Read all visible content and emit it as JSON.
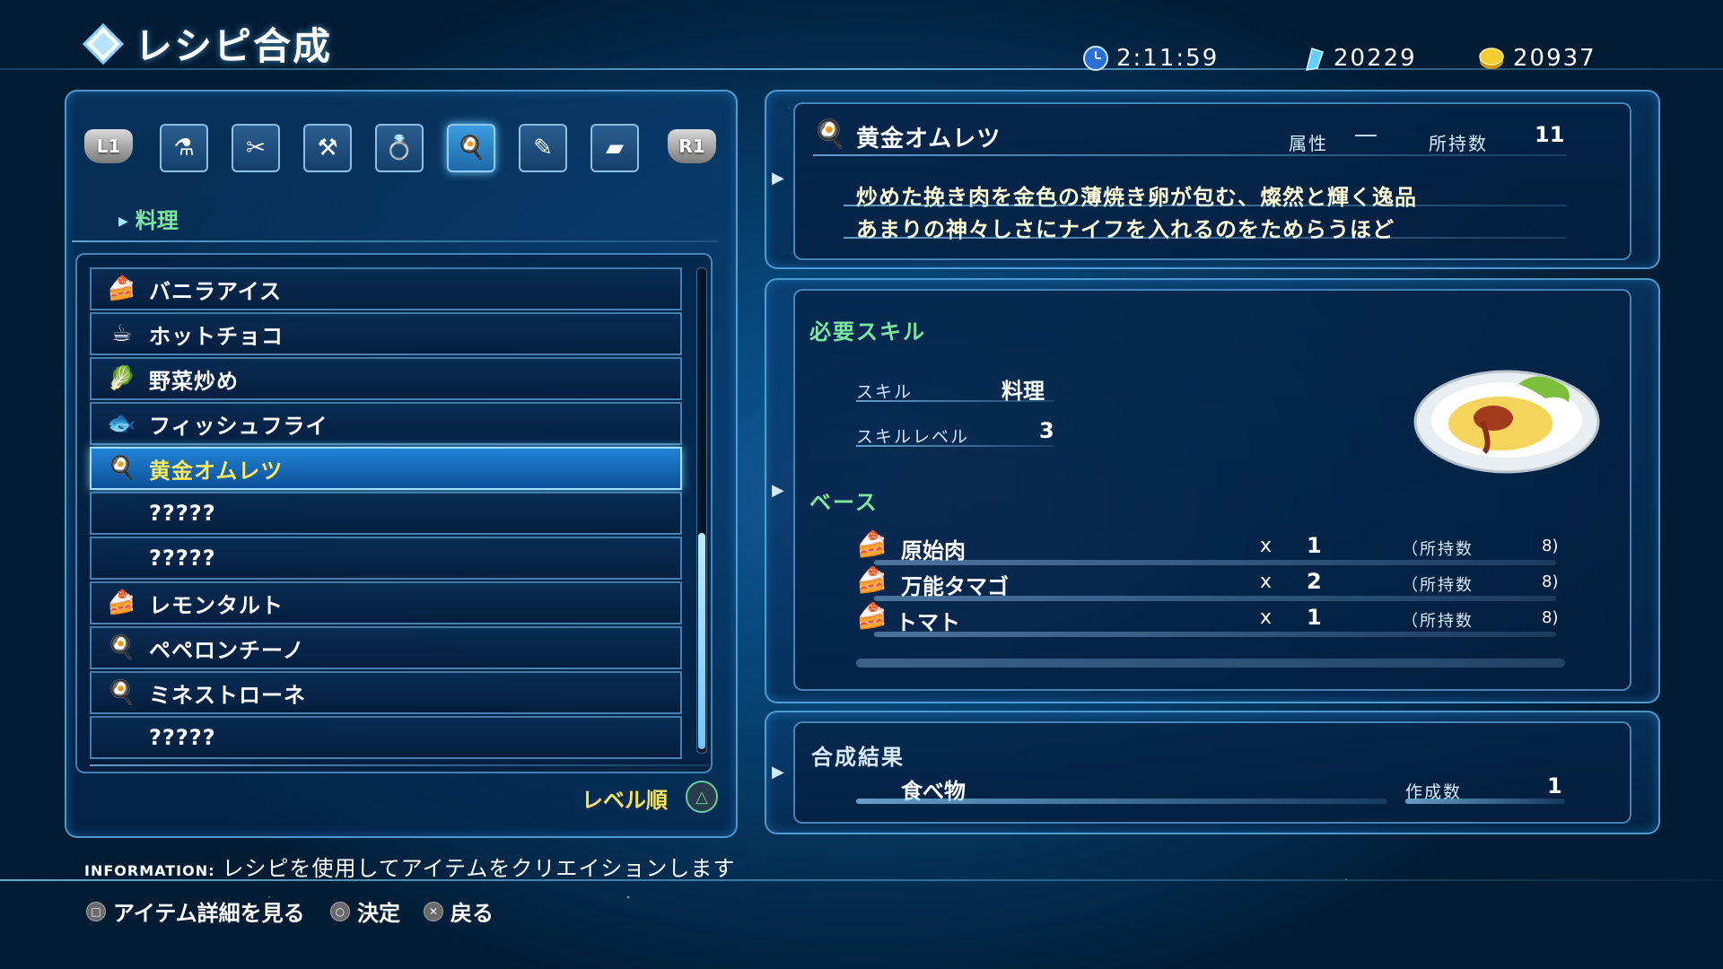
{
  "header": {
    "title": "レシピ合成",
    "time": "2:11:59",
    "crystals": "20229",
    "money": "20937"
  },
  "tabs": {
    "l1": "L1",
    "r1": "R1",
    "items": [
      {
        "icon": "potion-icon",
        "glyph": "⚗"
      },
      {
        "icon": "tools-icon",
        "glyph": "✂"
      },
      {
        "icon": "hammer-icon",
        "glyph": "⚒"
      },
      {
        "icon": "ring-icon",
        "glyph": "💍"
      },
      {
        "icon": "cooking-icon",
        "glyph": "🍳",
        "selected": true
      },
      {
        "icon": "writing-icon",
        "glyph": "✎"
      },
      {
        "icon": "ingot-icon",
        "glyph": "▰"
      }
    ]
  },
  "category": "料理",
  "recipes": [
    {
      "name": "バニラアイス",
      "icon": "cake-icon",
      "glyph": "🍰"
    },
    {
      "name": "ホットチョコ",
      "icon": "cup-icon",
      "glyph": "☕"
    },
    {
      "name": "野菜炒め",
      "icon": "vegetable-icon",
      "glyph": "🥬"
    },
    {
      "name": "フィッシュフライ",
      "icon": "fish-icon",
      "glyph": "🐟"
    },
    {
      "name": "黄金オムレツ",
      "icon": "omelet-icon",
      "glyph": "🍳",
      "selected": true
    },
    {
      "name": "?????",
      "icon": "",
      "glyph": ""
    },
    {
      "name": "?????",
      "icon": "",
      "glyph": ""
    },
    {
      "name": "レモンタルト",
      "icon": "cake-icon",
      "glyph": "🍰"
    },
    {
      "name": "ペペロンチーノ",
      "icon": "omelet-icon",
      "glyph": "🍳"
    },
    {
      "name": "ミネストローネ",
      "icon": "omelet-icon",
      "glyph": "🍳"
    },
    {
      "name": "?????",
      "icon": "",
      "glyph": ""
    }
  ],
  "sort_label": "レベル順",
  "scroll": {
    "position_fraction": 0.55,
    "visible_fraction": 0.45
  },
  "detail": {
    "name": "黄金オムレツ",
    "attr_label": "属性",
    "attr_value": "―",
    "owned_label": "所持数",
    "owned_value": "11",
    "desc_line1": "炒めた挽き肉を金色の薄焼き卵が包む、燦然と輝く逸品",
    "desc_line2": "あまりの神々しさにナイフを入れるのをためらうほど"
  },
  "skill": {
    "heading": "必要スキル",
    "skill_label": "スキル",
    "skill_value": "料理",
    "level_label": "スキルレベル",
    "level_value": "3"
  },
  "base": {
    "heading": "ベース",
    "times": "x",
    "owned_prefix": "（所持数",
    "materials": [
      {
        "name": "原始肉",
        "qty": "1",
        "owned": "8)"
      },
      {
        "name": "万能タマゴ",
        "qty": "2",
        "owned": "8)"
      },
      {
        "name": "トマト",
        "qty": "1",
        "owned": "8)"
      }
    ]
  },
  "result": {
    "heading": "合成結果",
    "item": "食べ物",
    "count_label": "作成数",
    "count_value": "1"
  },
  "information": {
    "label": "INFORMATION:",
    "text": "レシピを使用してアイテムをクリエイションします"
  },
  "help": {
    "details": "アイテム詳細を見る",
    "confirm": "決定",
    "back": "戻る"
  }
}
